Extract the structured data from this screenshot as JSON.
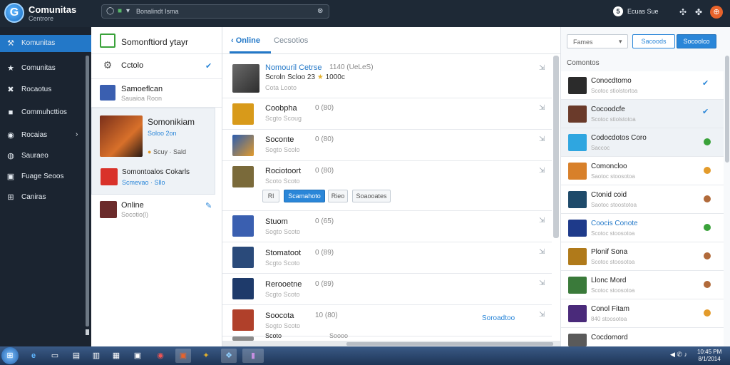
{
  "app": {
    "logo_glyph": "G",
    "title": "Comunitas",
    "subtitle": "Centrore"
  },
  "search": {
    "placeholder": "Bonalindt Isma"
  },
  "topbar": {
    "notif_count": "5",
    "notif_text": "Ecuas Sue"
  },
  "nav": {
    "items": [
      {
        "label": "Komunitas",
        "icon": "logo-icon",
        "glyph": "⚒"
      },
      {
        "label": "Comunitas",
        "icon": "star-icon",
        "glyph": "★"
      },
      {
        "label": "Rocaotus",
        "icon": "tools-icon",
        "glyph": "✖"
      },
      {
        "label": "Commuhcttios",
        "icon": "lock-icon",
        "glyph": "■"
      },
      {
        "label": "Rocaias",
        "icon": "gamepad-icon",
        "glyph": "◉"
      },
      {
        "label": "Sauraeo",
        "icon": "globe-icon",
        "glyph": "◍"
      },
      {
        "label": "Fuage Seoos",
        "icon": "gift-icon",
        "glyph": "▣"
      },
      {
        "label": "Caniras",
        "icon": "grid-icon",
        "glyph": "⊞"
      }
    ]
  },
  "friends": {
    "header": {
      "title": "Somonftiord ytayr"
    },
    "items": [
      {
        "name": "Cctolo",
        "sub": ""
      },
      {
        "name": "Samoeflcan",
        "sub": "Sauaioa Roon"
      },
      {
        "name": "Somonikiam",
        "sub": "Soloo 2on",
        "meta_a": "Scuy",
        "meta_b": "Sald"
      },
      {
        "name": "Somontoalos Cokarls",
        "sub": "Scmevao · Sllo"
      },
      {
        "name": "Online",
        "sub": "Socotio(l)"
      }
    ]
  },
  "main": {
    "tabs": [
      {
        "label": "Online"
      },
      {
        "label": "Cecsotios"
      }
    ],
    "rows": [
      {
        "name": "Nomouril Cetrse",
        "count": "1140 (UeLeS)",
        "sub": "Scroln Scloo 23",
        "sub2": "1000c",
        "sub3": "Cota  Looto"
      },
      {
        "name": "Coobpha",
        "count": "0    (80)",
        "sub": "Scgto  Scoug"
      },
      {
        "name": "Soconte",
        "count": "0    (80)",
        "sub": "Sogto  Scolo"
      },
      {
        "name": "Rociotoort",
        "count": "0    (80)",
        "sub": "Scoto  Scoto",
        "buttons": [
          "Rl",
          "Scamahoto",
          "Rieo",
          "Soaooates"
        ]
      },
      {
        "name": "Stuom",
        "count": "0    (65)",
        "sub": "Sogto  Scoto"
      },
      {
        "name": "Stomatoot",
        "count": "0    (89)",
        "sub": "Scgto  Scoto"
      },
      {
        "name": "Rerooetne",
        "count": "0    (89)",
        "sub": "Scgto  Scoto"
      },
      {
        "name": "Soocota",
        "count": "10   (80)",
        "sub": "Sogto  Scoto",
        "link": "Soroadtoo"
      },
      {
        "name": "Scoto",
        "count": "Soooo",
        "sub": ""
      }
    ]
  },
  "right": {
    "filter": "Fames",
    "btn1": "Sacoods",
    "btn2": "Socoolco",
    "header": "Comontos",
    "rows": [
      {
        "name": "Conocdtomo",
        "sub": "Scotoc stiolstortoa",
        "status": "check"
      },
      {
        "name": "Cocoodcfe",
        "sub": "Scotoc stiolstotoa",
        "status": "check"
      },
      {
        "name": "Codocdotos Coro",
        "sub": "Saccoc",
        "status": "green"
      },
      {
        "name": "Comoncloo",
        "sub": "Saotoc stoosotoa",
        "status": "orange"
      },
      {
        "name": "Ctonid coid",
        "sub": "Saotoc stoostotoa",
        "status": "brown"
      },
      {
        "name": "Coocis Conote",
        "sub": "Scotoc stoosotoa",
        "status": "green",
        "blue": true
      },
      {
        "name": "Plonif Sona",
        "sub": "Scotoc stoosotoa",
        "status": "brown"
      },
      {
        "name": "Llonc Mord",
        "sub": "Scotoc stoosotoa",
        "status": "brown"
      },
      {
        "name": "Conol Fitam",
        "sub": "840 stoosotoa",
        "status": "orange"
      },
      {
        "name": "Cocdomord",
        "sub": "",
        "status": ""
      }
    ]
  },
  "taskbar": {
    "tray": "◀ ✆ ♪",
    "clock_a": "10:45 PM",
    "clock_b": "8/1/2014"
  },
  "colors": {
    "accent": "#2378c8",
    "nav_bg": "#1b2430",
    "topbar_bg": "#1e2936"
  }
}
